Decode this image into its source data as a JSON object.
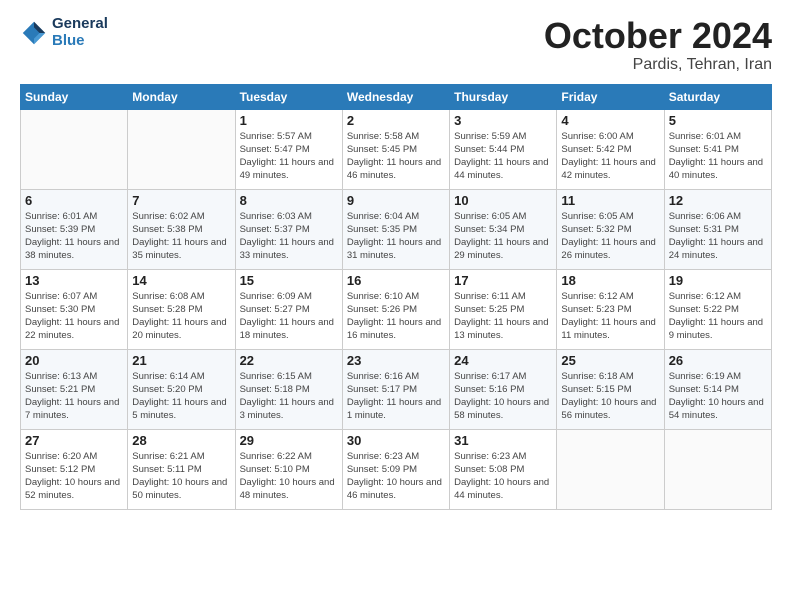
{
  "header": {
    "logo": {
      "general": "General",
      "blue": "Blue"
    },
    "title": "October 2024",
    "location": "Pardis, Tehran, Iran"
  },
  "weekdays": [
    "Sunday",
    "Monday",
    "Tuesday",
    "Wednesday",
    "Thursday",
    "Friday",
    "Saturday"
  ],
  "weeks": [
    [
      {
        "day": "",
        "sunrise": "",
        "sunset": "",
        "daylight": "",
        "empty": true
      },
      {
        "day": "",
        "sunrise": "",
        "sunset": "",
        "daylight": "",
        "empty": true
      },
      {
        "day": "1",
        "sunrise": "Sunrise: 5:57 AM",
        "sunset": "Sunset: 5:47 PM",
        "daylight": "Daylight: 11 hours and 49 minutes.",
        "empty": false
      },
      {
        "day": "2",
        "sunrise": "Sunrise: 5:58 AM",
        "sunset": "Sunset: 5:45 PM",
        "daylight": "Daylight: 11 hours and 46 minutes.",
        "empty": false
      },
      {
        "day": "3",
        "sunrise": "Sunrise: 5:59 AM",
        "sunset": "Sunset: 5:44 PM",
        "daylight": "Daylight: 11 hours and 44 minutes.",
        "empty": false
      },
      {
        "day": "4",
        "sunrise": "Sunrise: 6:00 AM",
        "sunset": "Sunset: 5:42 PM",
        "daylight": "Daylight: 11 hours and 42 minutes.",
        "empty": false
      },
      {
        "day": "5",
        "sunrise": "Sunrise: 6:01 AM",
        "sunset": "Sunset: 5:41 PM",
        "daylight": "Daylight: 11 hours and 40 minutes.",
        "empty": false
      }
    ],
    [
      {
        "day": "6",
        "sunrise": "Sunrise: 6:01 AM",
        "sunset": "Sunset: 5:39 PM",
        "daylight": "Daylight: 11 hours and 38 minutes.",
        "empty": false
      },
      {
        "day": "7",
        "sunrise": "Sunrise: 6:02 AM",
        "sunset": "Sunset: 5:38 PM",
        "daylight": "Daylight: 11 hours and 35 minutes.",
        "empty": false
      },
      {
        "day": "8",
        "sunrise": "Sunrise: 6:03 AM",
        "sunset": "Sunset: 5:37 PM",
        "daylight": "Daylight: 11 hours and 33 minutes.",
        "empty": false
      },
      {
        "day": "9",
        "sunrise": "Sunrise: 6:04 AM",
        "sunset": "Sunset: 5:35 PM",
        "daylight": "Daylight: 11 hours and 31 minutes.",
        "empty": false
      },
      {
        "day": "10",
        "sunrise": "Sunrise: 6:05 AM",
        "sunset": "Sunset: 5:34 PM",
        "daylight": "Daylight: 11 hours and 29 minutes.",
        "empty": false
      },
      {
        "day": "11",
        "sunrise": "Sunrise: 6:05 AM",
        "sunset": "Sunset: 5:32 PM",
        "daylight": "Daylight: 11 hours and 26 minutes.",
        "empty": false
      },
      {
        "day": "12",
        "sunrise": "Sunrise: 6:06 AM",
        "sunset": "Sunset: 5:31 PM",
        "daylight": "Daylight: 11 hours and 24 minutes.",
        "empty": false
      }
    ],
    [
      {
        "day": "13",
        "sunrise": "Sunrise: 6:07 AM",
        "sunset": "Sunset: 5:30 PM",
        "daylight": "Daylight: 11 hours and 22 minutes.",
        "empty": false
      },
      {
        "day": "14",
        "sunrise": "Sunrise: 6:08 AM",
        "sunset": "Sunset: 5:28 PM",
        "daylight": "Daylight: 11 hours and 20 minutes.",
        "empty": false
      },
      {
        "day": "15",
        "sunrise": "Sunrise: 6:09 AM",
        "sunset": "Sunset: 5:27 PM",
        "daylight": "Daylight: 11 hours and 18 minutes.",
        "empty": false
      },
      {
        "day": "16",
        "sunrise": "Sunrise: 6:10 AM",
        "sunset": "Sunset: 5:26 PM",
        "daylight": "Daylight: 11 hours and 16 minutes.",
        "empty": false
      },
      {
        "day": "17",
        "sunrise": "Sunrise: 6:11 AM",
        "sunset": "Sunset: 5:25 PM",
        "daylight": "Daylight: 11 hours and 13 minutes.",
        "empty": false
      },
      {
        "day": "18",
        "sunrise": "Sunrise: 6:12 AM",
        "sunset": "Sunset: 5:23 PM",
        "daylight": "Daylight: 11 hours and 11 minutes.",
        "empty": false
      },
      {
        "day": "19",
        "sunrise": "Sunrise: 6:12 AM",
        "sunset": "Sunset: 5:22 PM",
        "daylight": "Daylight: 11 hours and 9 minutes.",
        "empty": false
      }
    ],
    [
      {
        "day": "20",
        "sunrise": "Sunrise: 6:13 AM",
        "sunset": "Sunset: 5:21 PM",
        "daylight": "Daylight: 11 hours and 7 minutes.",
        "empty": false
      },
      {
        "day": "21",
        "sunrise": "Sunrise: 6:14 AM",
        "sunset": "Sunset: 5:20 PM",
        "daylight": "Daylight: 11 hours and 5 minutes.",
        "empty": false
      },
      {
        "day": "22",
        "sunrise": "Sunrise: 6:15 AM",
        "sunset": "Sunset: 5:18 PM",
        "daylight": "Daylight: 11 hours and 3 minutes.",
        "empty": false
      },
      {
        "day": "23",
        "sunrise": "Sunrise: 6:16 AM",
        "sunset": "Sunset: 5:17 PM",
        "daylight": "Daylight: 11 hours and 1 minute.",
        "empty": false
      },
      {
        "day": "24",
        "sunrise": "Sunrise: 6:17 AM",
        "sunset": "Sunset: 5:16 PM",
        "daylight": "Daylight: 10 hours and 58 minutes.",
        "empty": false
      },
      {
        "day": "25",
        "sunrise": "Sunrise: 6:18 AM",
        "sunset": "Sunset: 5:15 PM",
        "daylight": "Daylight: 10 hours and 56 minutes.",
        "empty": false
      },
      {
        "day": "26",
        "sunrise": "Sunrise: 6:19 AM",
        "sunset": "Sunset: 5:14 PM",
        "daylight": "Daylight: 10 hours and 54 minutes.",
        "empty": false
      }
    ],
    [
      {
        "day": "27",
        "sunrise": "Sunrise: 6:20 AM",
        "sunset": "Sunset: 5:12 PM",
        "daylight": "Daylight: 10 hours and 52 minutes.",
        "empty": false
      },
      {
        "day": "28",
        "sunrise": "Sunrise: 6:21 AM",
        "sunset": "Sunset: 5:11 PM",
        "daylight": "Daylight: 10 hours and 50 minutes.",
        "empty": false
      },
      {
        "day": "29",
        "sunrise": "Sunrise: 6:22 AM",
        "sunset": "Sunset: 5:10 PM",
        "daylight": "Daylight: 10 hours and 48 minutes.",
        "empty": false
      },
      {
        "day": "30",
        "sunrise": "Sunrise: 6:23 AM",
        "sunset": "Sunset: 5:09 PM",
        "daylight": "Daylight: 10 hours and 46 minutes.",
        "empty": false
      },
      {
        "day": "31",
        "sunrise": "Sunrise: 6:23 AM",
        "sunset": "Sunset: 5:08 PM",
        "daylight": "Daylight: 10 hours and 44 minutes.",
        "empty": false
      },
      {
        "day": "",
        "sunrise": "",
        "sunset": "",
        "daylight": "",
        "empty": true
      },
      {
        "day": "",
        "sunrise": "",
        "sunset": "",
        "daylight": "",
        "empty": true
      }
    ]
  ]
}
